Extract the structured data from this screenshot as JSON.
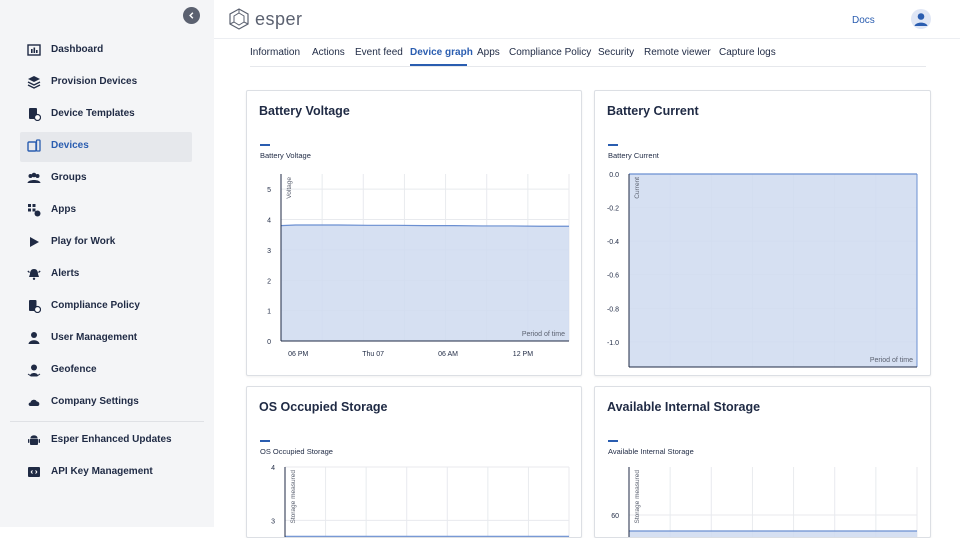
{
  "sidebar": {
    "items": [
      {
        "label": "Dashboard",
        "icon": "dashboard-icon"
      },
      {
        "label": "Provision Devices",
        "icon": "layers-icon"
      },
      {
        "label": "Device Templates",
        "icon": "template-icon"
      },
      {
        "label": "Devices",
        "icon": "devices-icon"
      },
      {
        "label": "Groups",
        "icon": "groups-icon"
      },
      {
        "label": "Apps",
        "icon": "apps-icon"
      },
      {
        "label": "Play for Work",
        "icon": "play-icon"
      },
      {
        "label": "Alerts",
        "icon": "alert-icon"
      },
      {
        "label": "Compliance Policy",
        "icon": "compliance-icon"
      },
      {
        "label": "User Management",
        "icon": "user-icon"
      },
      {
        "label": "Geofence",
        "icon": "geofence-icon"
      },
      {
        "label": "Company Settings",
        "icon": "cloud-icon"
      },
      {
        "label": "Esper Enhanced Updates",
        "icon": "android-icon"
      },
      {
        "label": "API Key Management",
        "icon": "api-key-icon"
      }
    ],
    "active_index": 3
  },
  "header": {
    "logo_text": "esper",
    "docs_label": "Docs"
  },
  "tabs": [
    "Information",
    "Actions",
    "Event feed",
    "Device graph",
    "Apps",
    "Compliance Policy",
    "Security",
    "Remote viewer",
    "Capture logs"
  ],
  "active_tab": 3,
  "colors": {
    "accent": "#2a5db0",
    "chart_fill": "#cfdaf0",
    "chart_line": "#6b8fd1"
  },
  "chart_data": [
    {
      "type": "area",
      "title": "Battery Voltage",
      "legend": [
        "Battery Voltage"
      ],
      "ylabel": "Voltage",
      "xlabel": "Period of time",
      "ylim": [
        0,
        5.5
      ],
      "yticks": [
        "0",
        "1",
        "2",
        "3",
        "4",
        "5"
      ],
      "xticks": [
        "06 PM",
        "Thu 07",
        "06 AM",
        "12 PM"
      ],
      "series": [
        {
          "name": "Battery Voltage",
          "x": [
            0,
            0.05,
            0.1,
            0.2,
            0.3,
            0.4,
            0.5,
            0.6,
            0.7,
            0.8,
            0.9,
            1
          ],
          "values": [
            3.8,
            3.82,
            3.82,
            3.82,
            3.81,
            3.81,
            3.8,
            3.8,
            3.79,
            3.79,
            3.78,
            3.78
          ]
        }
      ]
    },
    {
      "type": "area",
      "title": "Battery Current",
      "legend": [
        "Battery Current"
      ],
      "ylabel": "Current",
      "xlabel": "Period of time",
      "ylim": [
        -1.15,
        0
      ],
      "yticks": [
        "0.0",
        "-0.2",
        "-0.4",
        "-0.6",
        "-0.8",
        "-1.0"
      ],
      "xticks": [
        "06 PM",
        "Thu 07",
        "06 AM",
        "12 PM"
      ],
      "series": [
        {
          "name": "Battery Current",
          "x": [
            0,
            1
          ],
          "values": [
            0,
            0
          ]
        }
      ]
    },
    {
      "type": "area",
      "title": "OS Occupied Storage",
      "legend": [
        "OS Occupied Storage"
      ],
      "ylabel": "Storage measured",
      "ylim": [
        2.5,
        4
      ],
      "yticks": [
        "4",
        "3"
      ],
      "series": [
        {
          "name": "OS Occupied Storage",
          "x": [
            0,
            1
          ],
          "values": [
            2.7,
            2.7
          ]
        }
      ]
    },
    {
      "type": "area",
      "title": "Available Internal Storage",
      "legend": [
        "Available Internal Storage"
      ],
      "ylabel": "Storage measured",
      "ylim": [
        50,
        75
      ],
      "yticks": [
        "60"
      ],
      "series": [
        {
          "name": "Available Internal Storage",
          "x": [
            0,
            1
          ],
          "values": [
            55,
            55
          ]
        }
      ]
    }
  ]
}
